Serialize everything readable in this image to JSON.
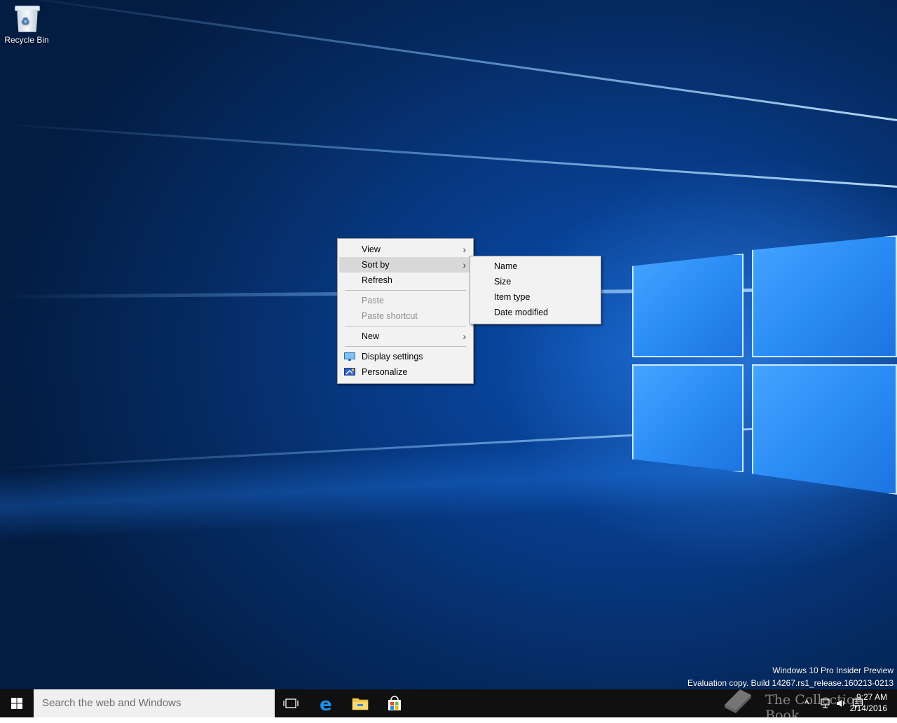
{
  "desktop": {
    "icons": [
      {
        "label": "Recycle Bin"
      }
    ]
  },
  "context_menu": {
    "items": [
      {
        "label": "View",
        "has_submenu": true,
        "disabled": false
      },
      {
        "label": "Sort by",
        "has_submenu": true,
        "disabled": false,
        "highlighted": true
      },
      {
        "label": "Refresh",
        "has_submenu": false,
        "disabled": false
      },
      {
        "label": "Paste",
        "has_submenu": false,
        "disabled": true
      },
      {
        "label": "Paste shortcut",
        "has_submenu": false,
        "disabled": true
      },
      {
        "label": "New",
        "has_submenu": true,
        "disabled": false
      },
      {
        "label": "Display settings",
        "icon": "display-settings-icon",
        "disabled": false
      },
      {
        "label": "Personalize",
        "icon": "personalize-icon",
        "disabled": false
      }
    ],
    "submenu_arrow": "›"
  },
  "sort_submenu": {
    "items": [
      {
        "label": "Name"
      },
      {
        "label": "Size"
      },
      {
        "label": "Item type"
      },
      {
        "label": "Date modified"
      }
    ]
  },
  "watermark": {
    "line1": "Windows 10 Pro Insider Preview",
    "line2": "Evaluation copy. Build 14267.rs1_release.160213-0213"
  },
  "taskbar": {
    "search_placeholder": "Search the web and Windows",
    "pinned": [
      {
        "icon": "task-view-icon"
      },
      {
        "icon": "edge-icon"
      },
      {
        "icon": "file-explorer-icon"
      },
      {
        "icon": "store-icon"
      }
    ],
    "tray": {
      "chevron": "^",
      "clock_time": "9:27 AM",
      "clock_date": "2/14/2016"
    }
  },
  "overlay_brand": {
    "text": "The Collection Book"
  }
}
